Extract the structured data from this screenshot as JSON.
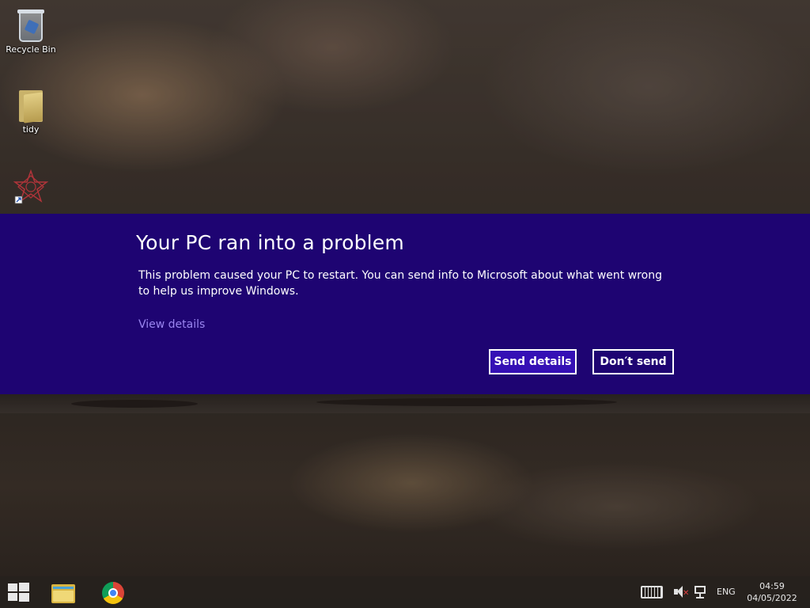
{
  "desktop": {
    "icons": [
      {
        "label": "Recycle Bin",
        "icon": "recycle-bin-icon"
      },
      {
        "label": "tidy",
        "icon": "folder-icon"
      },
      {
        "label": "",
        "icon": "star-shortcut-icon"
      }
    ]
  },
  "error_banner": {
    "title": "Your PC ran into a problem",
    "message": "This problem caused your PC to restart. You can send info to Microsoft about what went wrong to help us improve Windows.",
    "link": "View details",
    "primary_button": "Send details",
    "secondary_button": "Don′t send",
    "background_color": "#1e0472",
    "link_color": "#9a86f0"
  },
  "taskbar": {
    "start_icon": "windows-logo-icon",
    "apps": [
      {
        "name": "file-explorer",
        "icon": "file-explorer-icon"
      },
      {
        "name": "google-chrome",
        "icon": "chrome-icon"
      }
    ],
    "tray": {
      "keyboard_icon": "touch-keyboard-icon",
      "volume_icon": "volume-muted-icon",
      "network_icon": "network-icon",
      "language": "ENG",
      "time": "04:59",
      "date": "04/05/2022"
    }
  }
}
